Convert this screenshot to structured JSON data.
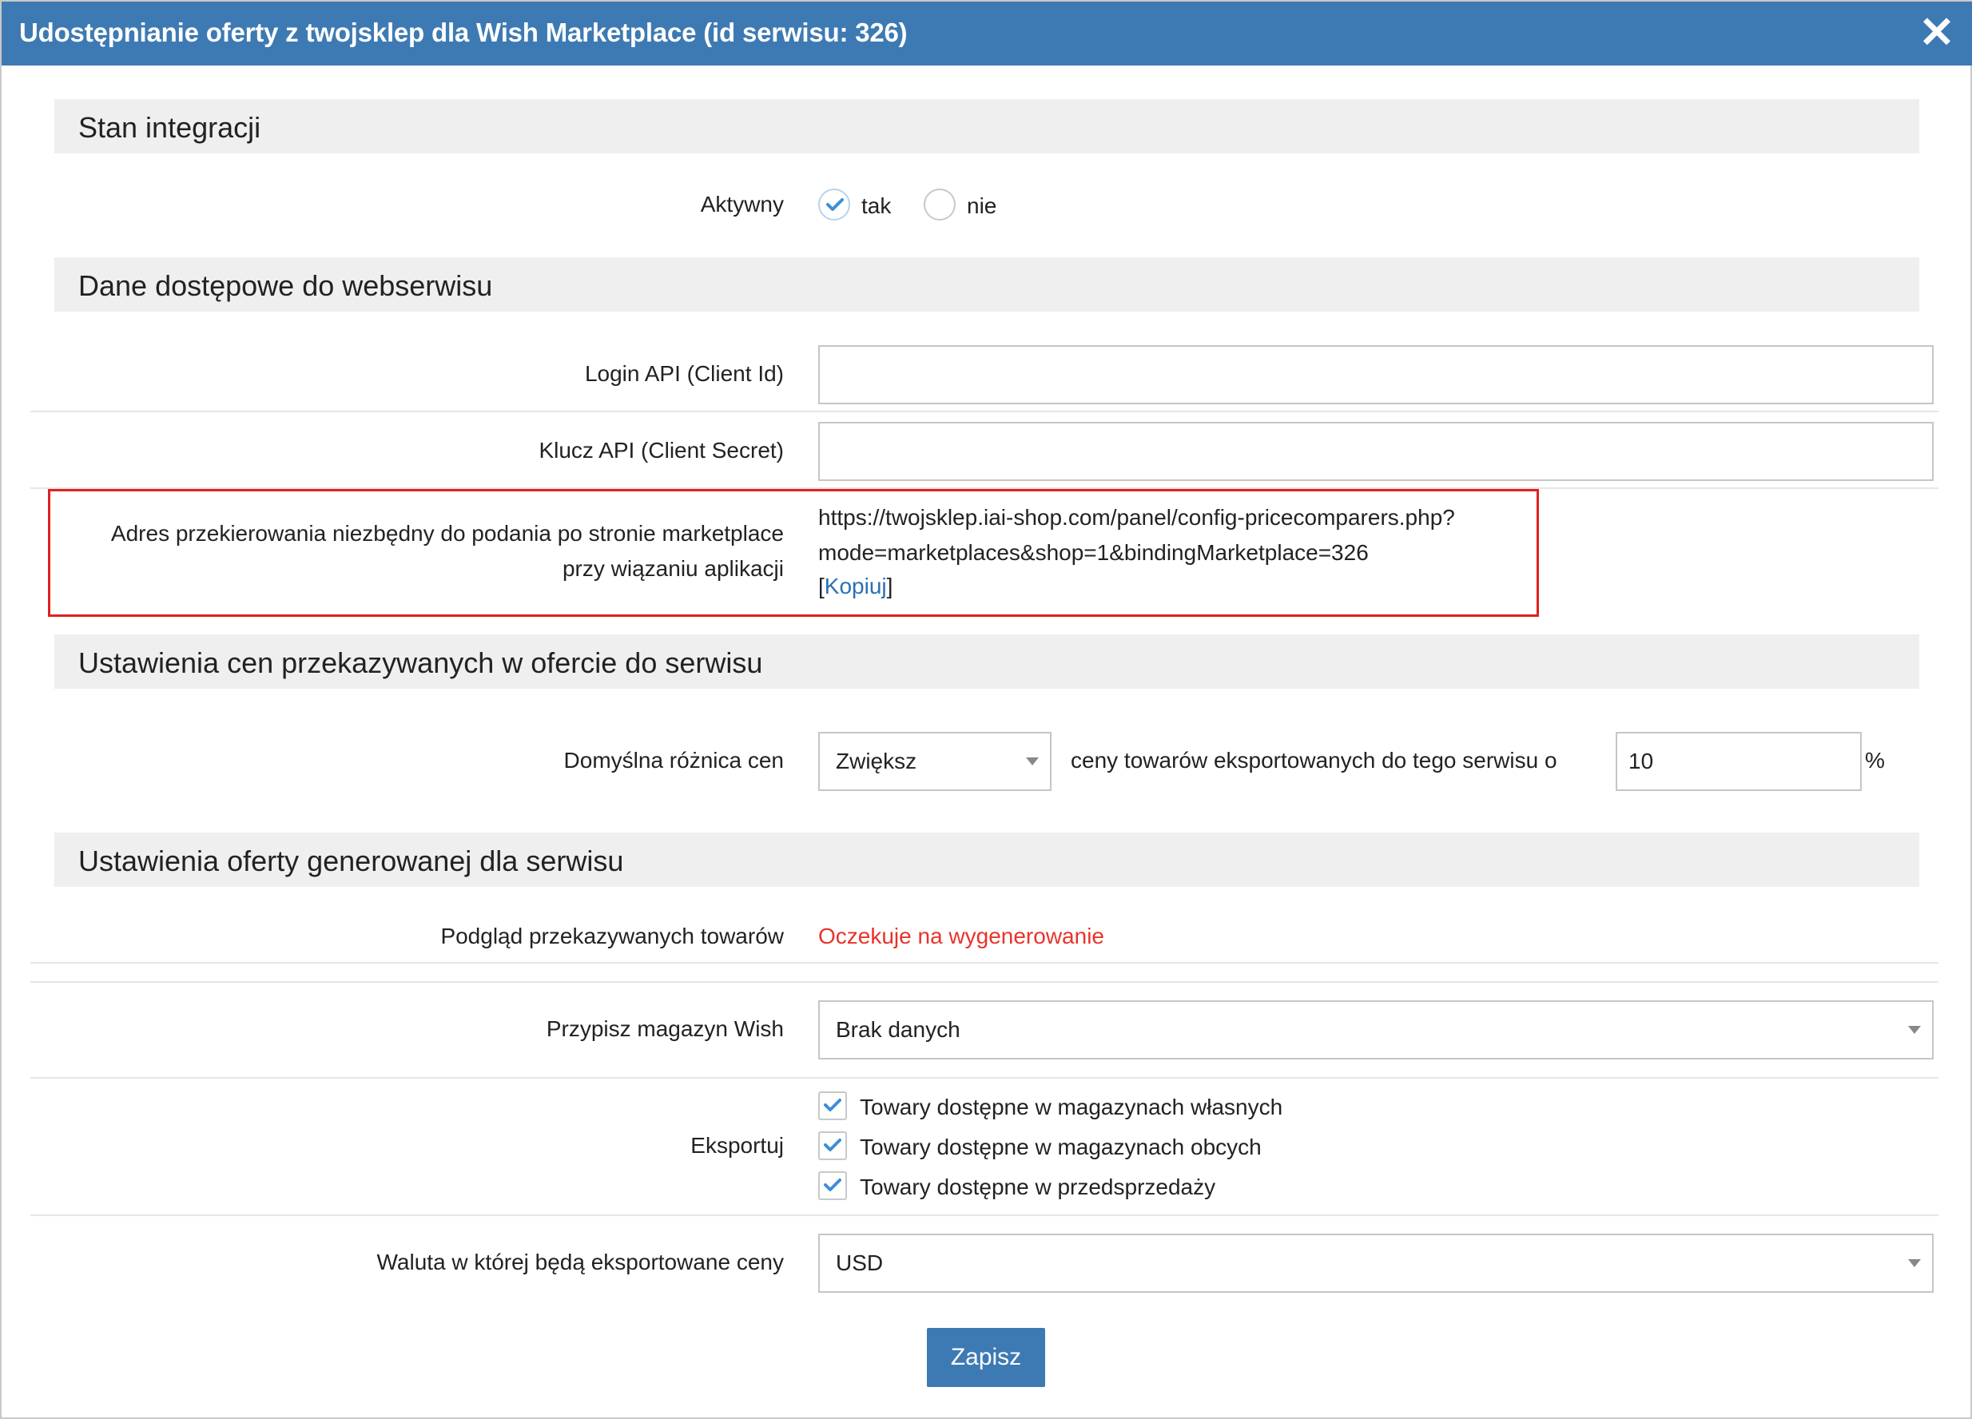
{
  "dialog": {
    "title": "Udostępnianie oferty z twojsklep dla Wish Marketplace (id serwisu: 326)",
    "close_symbol": "✕"
  },
  "sections": {
    "integration": "Stan integracji",
    "access": "Dane dostępowe do webserwisu",
    "prices": "Ustawienia cen przekazywanych w ofercie do serwisu",
    "offer": "Ustawienia oferty generowanej dla serwisu"
  },
  "active": {
    "label": "Aktywny",
    "options": [
      "tak",
      "nie"
    ],
    "selected": "tak"
  },
  "api": {
    "login_label": "Login API (Client Id)",
    "login_value": "",
    "secret_label": "Klucz API (Client Secret)",
    "secret_value": ""
  },
  "redirect": {
    "label_line1": "Adres przekierowania niezbędny do podania po stronie marketplace",
    "label_line2": "przy wiązaniu aplikacji",
    "url_line1": "https://twojsklep.iai-shop.com/panel/config-pricecomparers.php?",
    "url_line2": "mode=marketplaces&shop=1&bindingMarketplace=326",
    "copy_open": "[",
    "copy_link": "Kopiuj",
    "copy_close": "]"
  },
  "price_diff": {
    "label": "Domyślna różnica cen",
    "select_value": "Zwiększ",
    "middle_text": "ceny towarów eksportowanych do tego serwisu o",
    "amount": "10",
    "unit": "%"
  },
  "preview": {
    "label": "Podgląd przekazywanych towarów",
    "status": "Oczekuje na wygenerowanie",
    "status_color": "#e8332b"
  },
  "warehouse": {
    "label": "Przypisz magazyn Wish",
    "value": "Brak danych"
  },
  "export": {
    "label": "Eksportuj",
    "options": [
      "Towary dostępne w magazynach własnych",
      "Towary dostępne w magazynach obcych",
      "Towary dostępne w przedsprzedaży"
    ],
    "checked": [
      true,
      true,
      true
    ]
  },
  "currency": {
    "label": "Waluta w której będą eksportowane ceny",
    "value": "USD"
  },
  "save_button": "Zapisz",
  "colors": {
    "titlebar": "#3d7ab3",
    "check": "#3d8fd6",
    "highlight_border": "#e02020",
    "link": "#2a6fb6"
  }
}
